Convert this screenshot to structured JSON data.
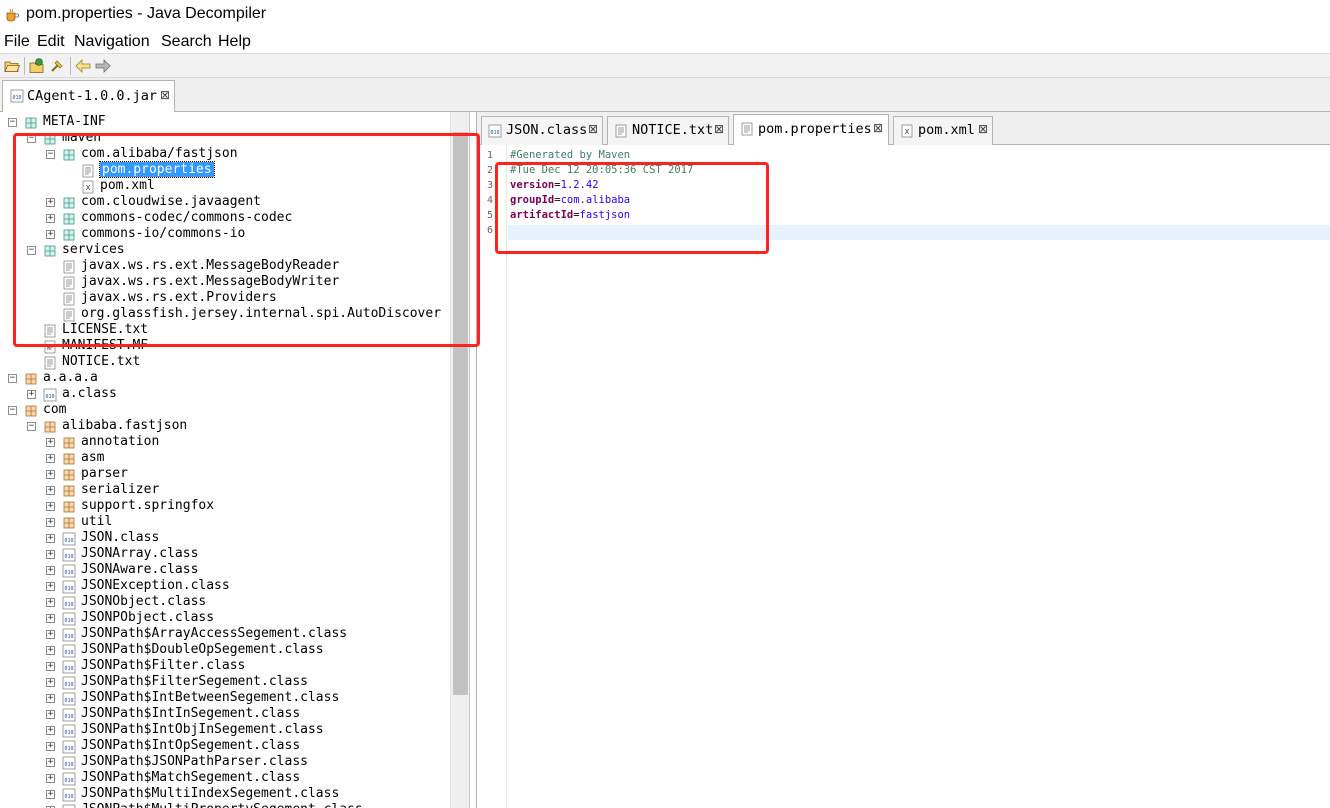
{
  "window": {
    "title": "pom.properties - Java Decompiler"
  },
  "menu": [
    "File",
    "Edit",
    "Navigation",
    "Search",
    "Help"
  ],
  "toolbar": {
    "buttons": [
      "open-file-icon",
      "open-type-icon",
      "search-icon",
      "back-icon",
      "forward-icon"
    ]
  },
  "outer_tab": {
    "label": "CAgent-1.0.0.jar",
    "close": "⊠"
  },
  "tree": [
    {
      "label": "META-INF"
    },
    {
      "label": "maven"
    },
    {
      "label": "com.alibaba/fastjson"
    },
    {
      "label": "pom.properties"
    },
    {
      "label": "pom.xml"
    },
    {
      "label": "com.cloudwise.javaagent"
    },
    {
      "label": "commons-codec/commons-codec"
    },
    {
      "label": "commons-io/commons-io"
    },
    {
      "label": "services"
    },
    {
      "label": "javax.ws.rs.ext.MessageBodyReader"
    },
    {
      "label": "javax.ws.rs.ext.MessageBodyWriter"
    },
    {
      "label": "javax.ws.rs.ext.Providers"
    },
    {
      "label": "org.glassfish.jersey.internal.spi.AutoDiscover"
    },
    {
      "label": "LICENSE.txt"
    },
    {
      "label": "MANIFEST.MF"
    },
    {
      "label": "NOTICE.txt"
    },
    {
      "label": "a.a.a.a"
    },
    {
      "label": "a.class"
    },
    {
      "label": "com"
    },
    {
      "label": "alibaba.fastjson"
    },
    {
      "label": "annotation"
    },
    {
      "label": "asm"
    },
    {
      "label": "parser"
    },
    {
      "label": "serializer"
    },
    {
      "label": "support.springfox"
    },
    {
      "label": "util"
    },
    {
      "label": "JSON.class"
    },
    {
      "label": "JSONArray.class"
    },
    {
      "label": "JSONAware.class"
    },
    {
      "label": "JSONException.class"
    },
    {
      "label": "JSONObject.class"
    },
    {
      "label": "JSONPObject.class"
    },
    {
      "label": "JSONPath$ArrayAccessSegement.class"
    },
    {
      "label": "JSONPath$DoubleOpSegement.class"
    },
    {
      "label": "JSONPath$Filter.class"
    },
    {
      "label": "JSONPath$FilterSegement.class"
    },
    {
      "label": "JSONPath$IntBetweenSegement.class"
    },
    {
      "label": "JSONPath$IntInSegement.class"
    },
    {
      "label": "JSONPath$IntObjInSegement.class"
    },
    {
      "label": "JSONPath$IntOpSegement.class"
    },
    {
      "label": "JSONPath$JSONPathParser.class"
    },
    {
      "label": "JSONPath$MatchSegement.class"
    },
    {
      "label": "JSONPath$MultiIndexSegement.class"
    },
    {
      "label": "JSONPath$MultiPropertySegement.class"
    }
  ],
  "editor_tabs": [
    {
      "label": "JSON.class",
      "close": "⊠"
    },
    {
      "label": "NOTICE.txt",
      "close": "⊠"
    },
    {
      "label": "pom.properties",
      "close": "⊠"
    },
    {
      "label": "pom.xml",
      "close": "⊠"
    }
  ],
  "editor": {
    "line_numbers": [
      "1",
      "2",
      "3",
      "4",
      "5",
      "6"
    ],
    "comment1": "#Generated by Maven",
    "comment2": "#Tue Dec 12 20:05:36 CST 2017",
    "props": [
      {
        "key": "version",
        "eq": "=",
        "value": "1.2.42"
      },
      {
        "key": "groupId",
        "eq": "=",
        "value": "com.alibaba"
      },
      {
        "key": "artifactId",
        "eq": "=",
        "value": "fastjson"
      }
    ]
  },
  "colors": {
    "selection": "#3399ff",
    "annotation": "#ff2020",
    "comment": "#3f7f5f",
    "key": "#7f0055",
    "value": "#2a00ff"
  }
}
